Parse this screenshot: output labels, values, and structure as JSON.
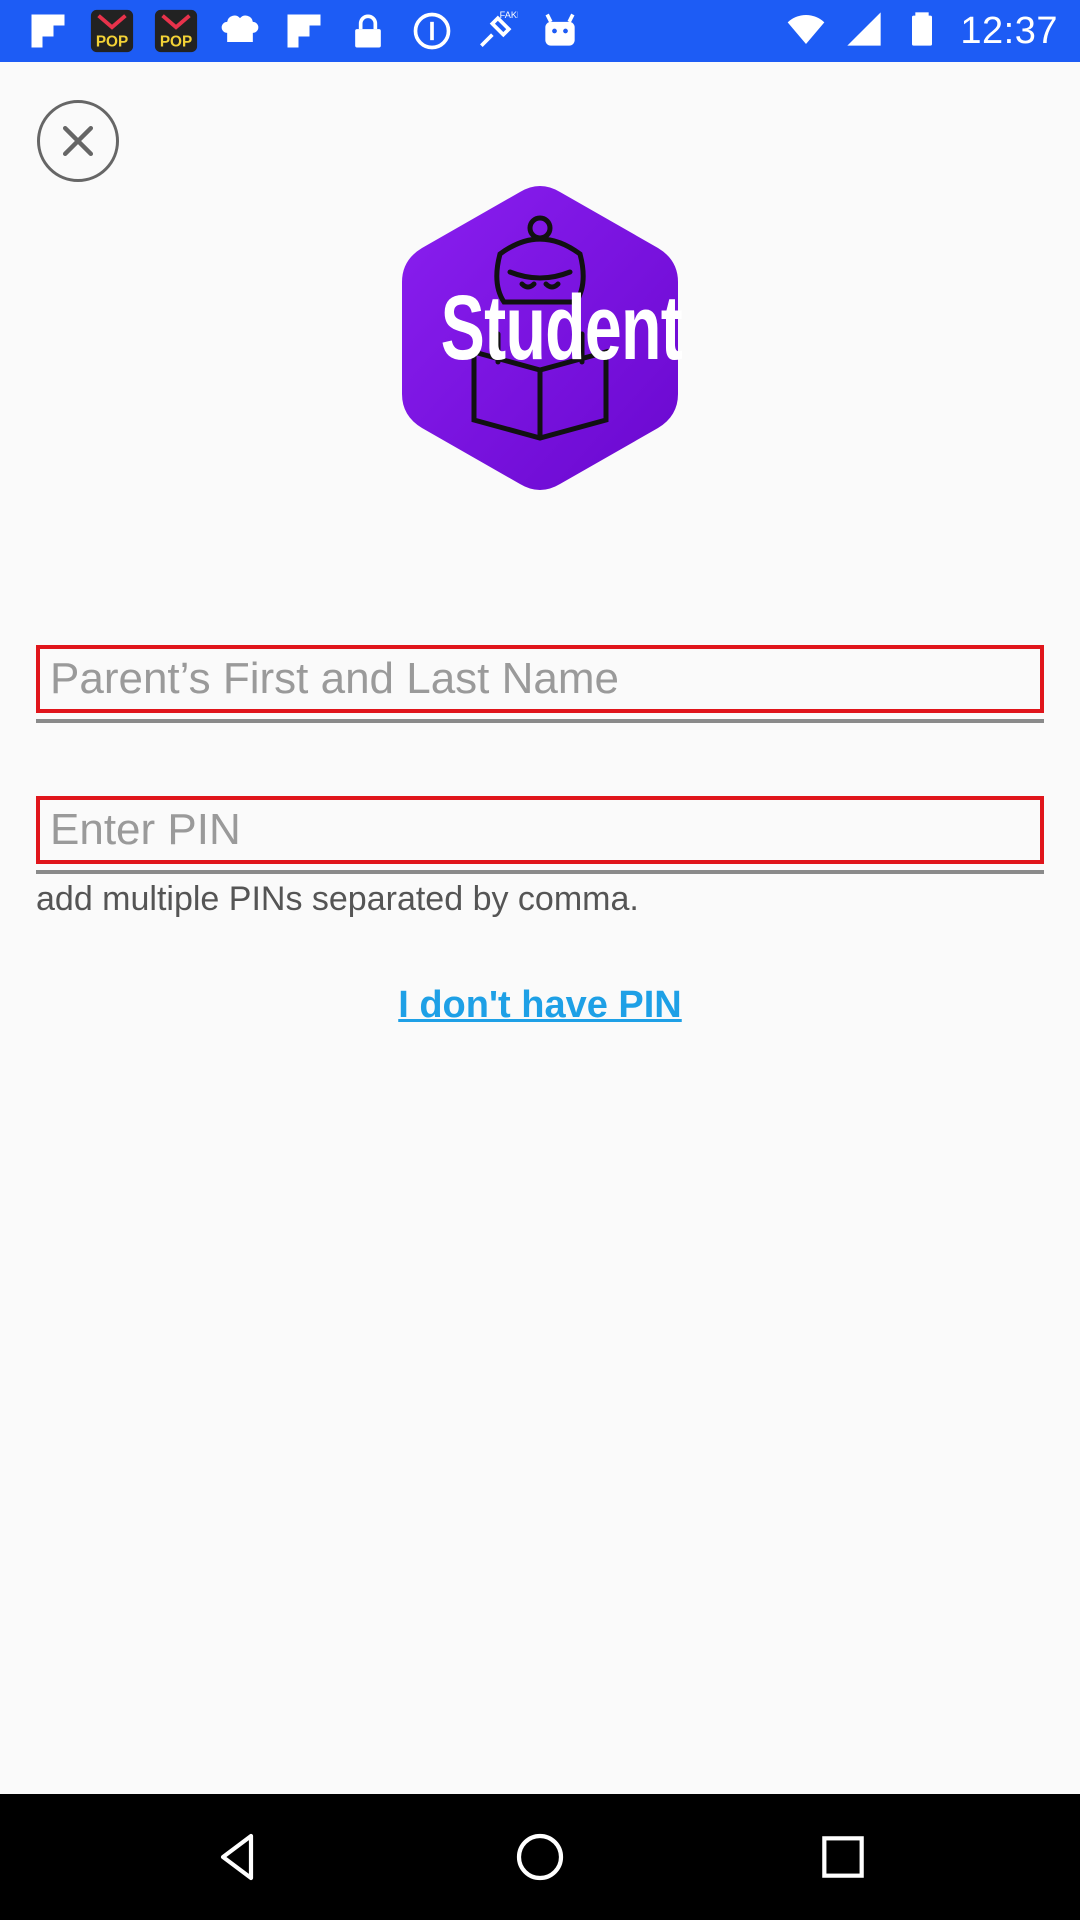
{
  "status_bar": {
    "time": "12:37",
    "icons": [
      "flipboard-icon",
      "pop-app-icon",
      "pop-app-icon",
      "cloud-chat-icon",
      "flipboard-icon",
      "lock-icon",
      "info-circle-icon",
      "fake-gps-icon",
      "android-icon"
    ],
    "right_icons": [
      "wifi-icon",
      "signal-icon",
      "battery-icon"
    ],
    "background": "#1d5cf5"
  },
  "logo": {
    "text": "Student",
    "color": "#7a10e0"
  },
  "form": {
    "name_field": {
      "placeholder": "Parent’s First and Last Name",
      "value": ""
    },
    "pin_field": {
      "placeholder": "Enter PIN",
      "value": ""
    },
    "pin_hint": "add multiple PINs separated by comma.",
    "no_pin_link": "I don't have PIN",
    "highlight_color": "#e0151b",
    "link_color": "#1ea0e6"
  },
  "nav_bar": {
    "buttons": [
      "back-icon",
      "home-icon",
      "recents-icon"
    ]
  }
}
